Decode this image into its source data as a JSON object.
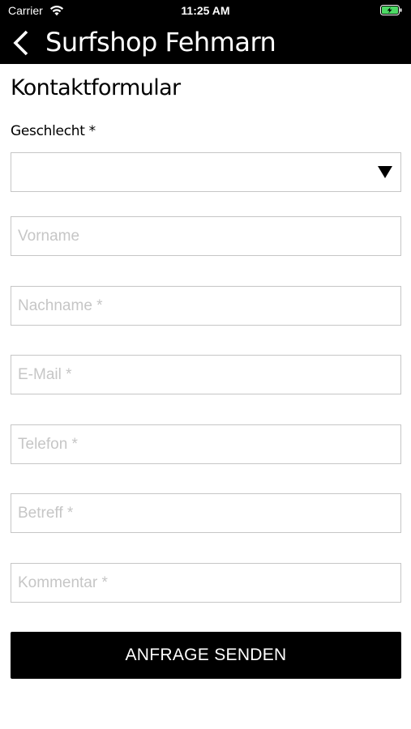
{
  "status_bar": {
    "carrier": "Carrier",
    "time": "11:25 AM"
  },
  "nav": {
    "title": "Surfshop Fehmarn"
  },
  "form": {
    "title": "Kontaktformular",
    "gender_label": "Geschlecht *",
    "gender_value": "",
    "fields": {
      "first_name": {
        "placeholder": "Vorname",
        "value": ""
      },
      "last_name": {
        "placeholder": "Nachname *",
        "value": ""
      },
      "email": {
        "placeholder": "E-Mail *",
        "value": ""
      },
      "phone": {
        "placeholder": "Telefon *",
        "value": ""
      },
      "subject": {
        "placeholder": "Betreff *",
        "value": ""
      },
      "comment": {
        "placeholder": "Kommentar *",
        "value": ""
      }
    },
    "submit_label": "ANFRAGE SENDEN"
  },
  "colors": {
    "header_background": "#000000",
    "header_text": "#ffffff",
    "field_border": "#c6c6c6",
    "placeholder": "#c6c6c6",
    "button_background": "#000000",
    "button_text": "#ffffff"
  },
  "icons": {
    "wifi": "wifi-icon",
    "battery": "battery-charging-icon",
    "back": "chevron-left-icon",
    "dropdown": "triangle-down-icon"
  }
}
